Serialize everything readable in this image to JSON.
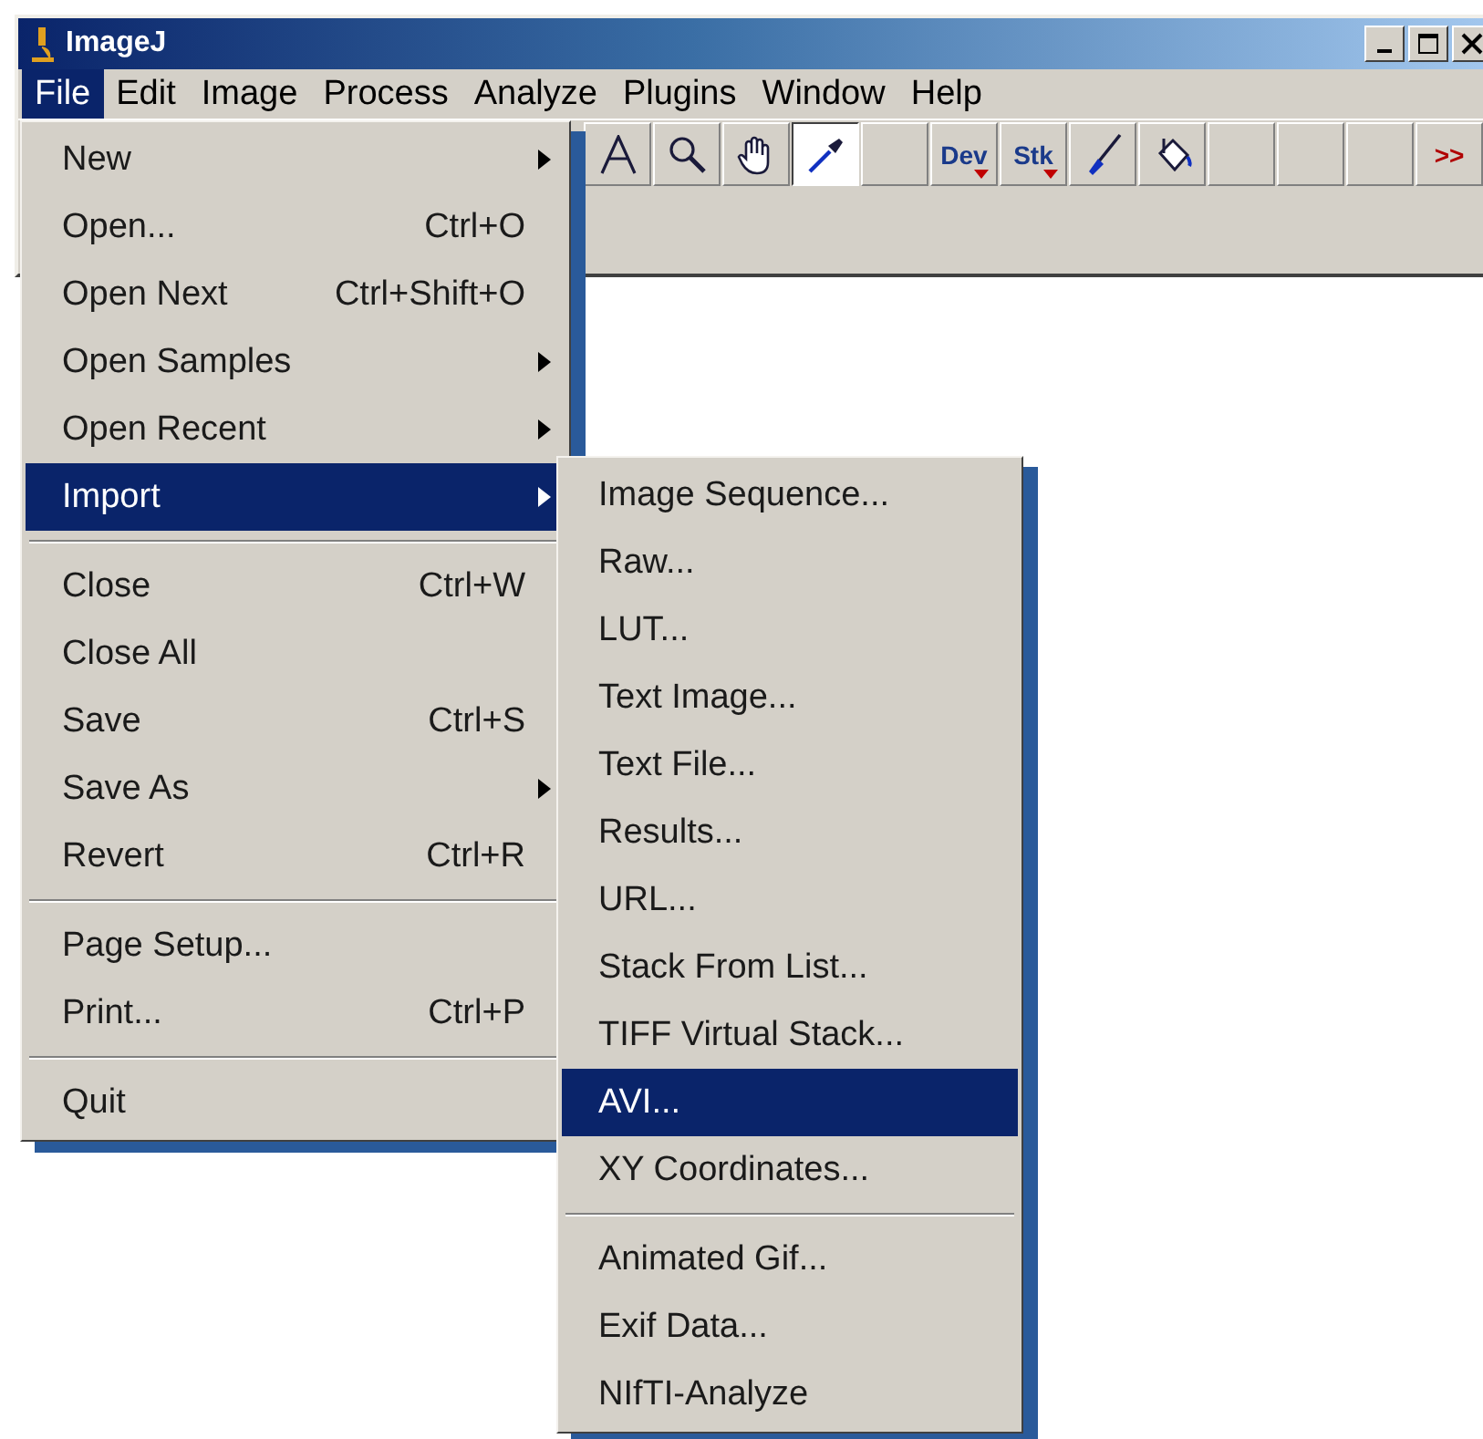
{
  "window": {
    "title": "ImageJ"
  },
  "menubar": [
    {
      "label": "File",
      "selected": true
    },
    {
      "label": "Edit",
      "selected": false
    },
    {
      "label": "Image",
      "selected": false
    },
    {
      "label": "Process",
      "selected": false
    },
    {
      "label": "Analyze",
      "selected": false
    },
    {
      "label": "Plugins",
      "selected": false
    },
    {
      "label": "Window",
      "selected": false
    },
    {
      "label": "Help",
      "selected": false
    }
  ],
  "toolbar": [
    {
      "kind": "text",
      "selected": false
    },
    {
      "kind": "zoom",
      "selected": false
    },
    {
      "kind": "hand",
      "selected": false
    },
    {
      "kind": "dropper",
      "selected": true
    },
    {
      "kind": "blank",
      "selected": false
    },
    {
      "kind": "menu",
      "label": "Dev",
      "selected": false
    },
    {
      "kind": "menu",
      "label": "Stk",
      "selected": false
    },
    {
      "kind": "brush",
      "selected": false
    },
    {
      "kind": "fill",
      "selected": false
    },
    {
      "kind": "blank",
      "selected": false
    },
    {
      "kind": "blank",
      "selected": false
    },
    {
      "kind": "blank",
      "selected": false
    },
    {
      "kind": "more",
      "label": ">>",
      "selected": false
    }
  ],
  "file_menu": [
    {
      "kind": "item",
      "label": "New",
      "submenu": true,
      "selected": false
    },
    {
      "kind": "item",
      "label": "Open...",
      "shortcut": "Ctrl+O",
      "selected": false
    },
    {
      "kind": "item",
      "label": "Open Next",
      "shortcut": "Ctrl+Shift+O",
      "selected": false
    },
    {
      "kind": "item",
      "label": "Open Samples",
      "submenu": true,
      "selected": false
    },
    {
      "kind": "item",
      "label": "Open Recent",
      "submenu": true,
      "selected": false
    },
    {
      "kind": "item",
      "label": "Import",
      "submenu": true,
      "selected": true
    },
    {
      "kind": "separator"
    },
    {
      "kind": "item",
      "label": "Close",
      "shortcut": "Ctrl+W",
      "selected": false
    },
    {
      "kind": "item",
      "label": "Close All",
      "selected": false
    },
    {
      "kind": "item",
      "label": "Save",
      "shortcut": "Ctrl+S",
      "selected": false
    },
    {
      "kind": "item",
      "label": "Save As",
      "submenu": true,
      "selected": false
    },
    {
      "kind": "item",
      "label": "Revert",
      "shortcut": "Ctrl+R",
      "selected": false
    },
    {
      "kind": "separator"
    },
    {
      "kind": "item",
      "label": "Page Setup...",
      "selected": false
    },
    {
      "kind": "item",
      "label": "Print...",
      "shortcut": "Ctrl+P",
      "selected": false
    },
    {
      "kind": "separator"
    },
    {
      "kind": "item",
      "label": "Quit",
      "selected": false
    }
  ],
  "import_menu": [
    {
      "kind": "item",
      "label": "Image Sequence...",
      "selected": false
    },
    {
      "kind": "item",
      "label": "Raw...",
      "selected": false
    },
    {
      "kind": "item",
      "label": "LUT...",
      "selected": false
    },
    {
      "kind": "item",
      "label": "Text Image...",
      "selected": false
    },
    {
      "kind": "item",
      "label": "Text File...",
      "selected": false
    },
    {
      "kind": "item",
      "label": "Results...",
      "selected": false
    },
    {
      "kind": "item",
      "label": "URL...",
      "selected": false
    },
    {
      "kind": "item",
      "label": "Stack From List...",
      "selected": false
    },
    {
      "kind": "item",
      "label": "TIFF Virtual Stack...",
      "selected": false
    },
    {
      "kind": "item",
      "label": "AVI...",
      "selected": true
    },
    {
      "kind": "item",
      "label": "XY Coordinates...",
      "selected": false
    },
    {
      "kind": "separator"
    },
    {
      "kind": "item",
      "label": "Animated Gif...",
      "selected": false
    },
    {
      "kind": "item",
      "label": "Exif Data...",
      "selected": false
    },
    {
      "kind": "item",
      "label": "NIfTI-Analyze",
      "selected": false
    }
  ]
}
